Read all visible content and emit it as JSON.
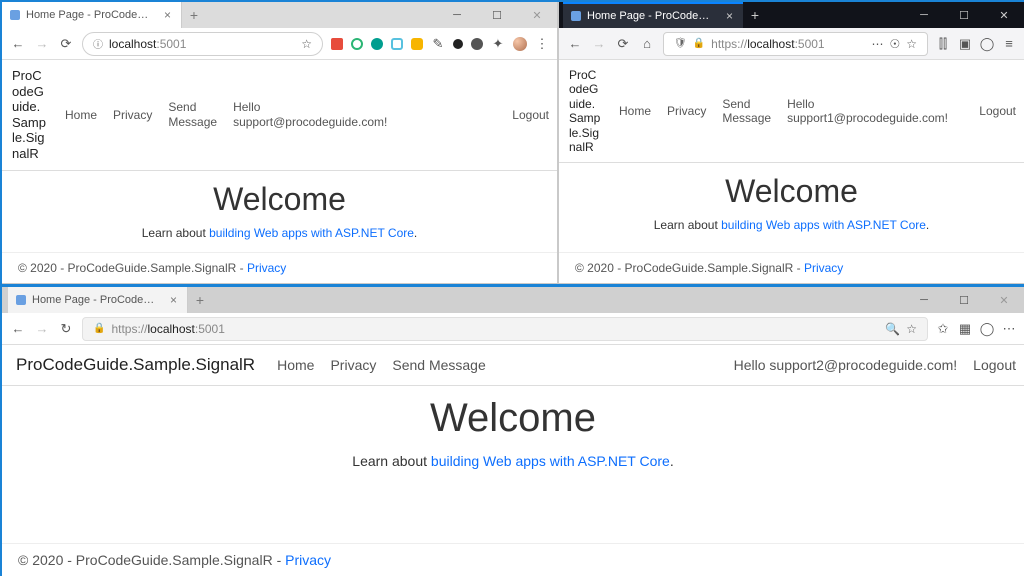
{
  "tab_title": "Home Page - ProCodeGuide.Sam...",
  "tab_title_ff": "Home Page - ProCodeGuide.S",
  "tab_title_edge": "Home Page - ProCodeGuide.San",
  "chrome": {
    "url_host": "localhost",
    "url_port": ":5001"
  },
  "firefox": {
    "url_prefix": "https://",
    "url_host": "localhost",
    "url_port": ":5001"
  },
  "edge": {
    "url_prefix": "https://",
    "url_host": "localhost",
    "url_port": ":5001"
  },
  "app": {
    "brand_narrow": "ProCodeGuide.Sample.SignalR",
    "brand_wide": "ProCodeGuide.Sample.SignalR",
    "nav_home": "Home",
    "nav_privacy": "Privacy",
    "nav_send": "Send Message",
    "nav_send_l1": "Send",
    "nav_send_l2": "Message",
    "hello_prefix_l1": "Hello",
    "hello_user1": "support@procodeguide.com!",
    "hello_user2": "support1@procodeguide.com!",
    "hello_user3_full": "Hello support2@procodeguide.com!",
    "logout": "Logout",
    "welcome": "Welcome",
    "learn_prefix": "Learn about ",
    "learn_link": "building Web apps with ASP.NET Core",
    "learn_suffix": ".",
    "footer_text": "© 2020 - ProCodeGuide.Sample.SignalR - ",
    "footer_link": "Privacy"
  }
}
